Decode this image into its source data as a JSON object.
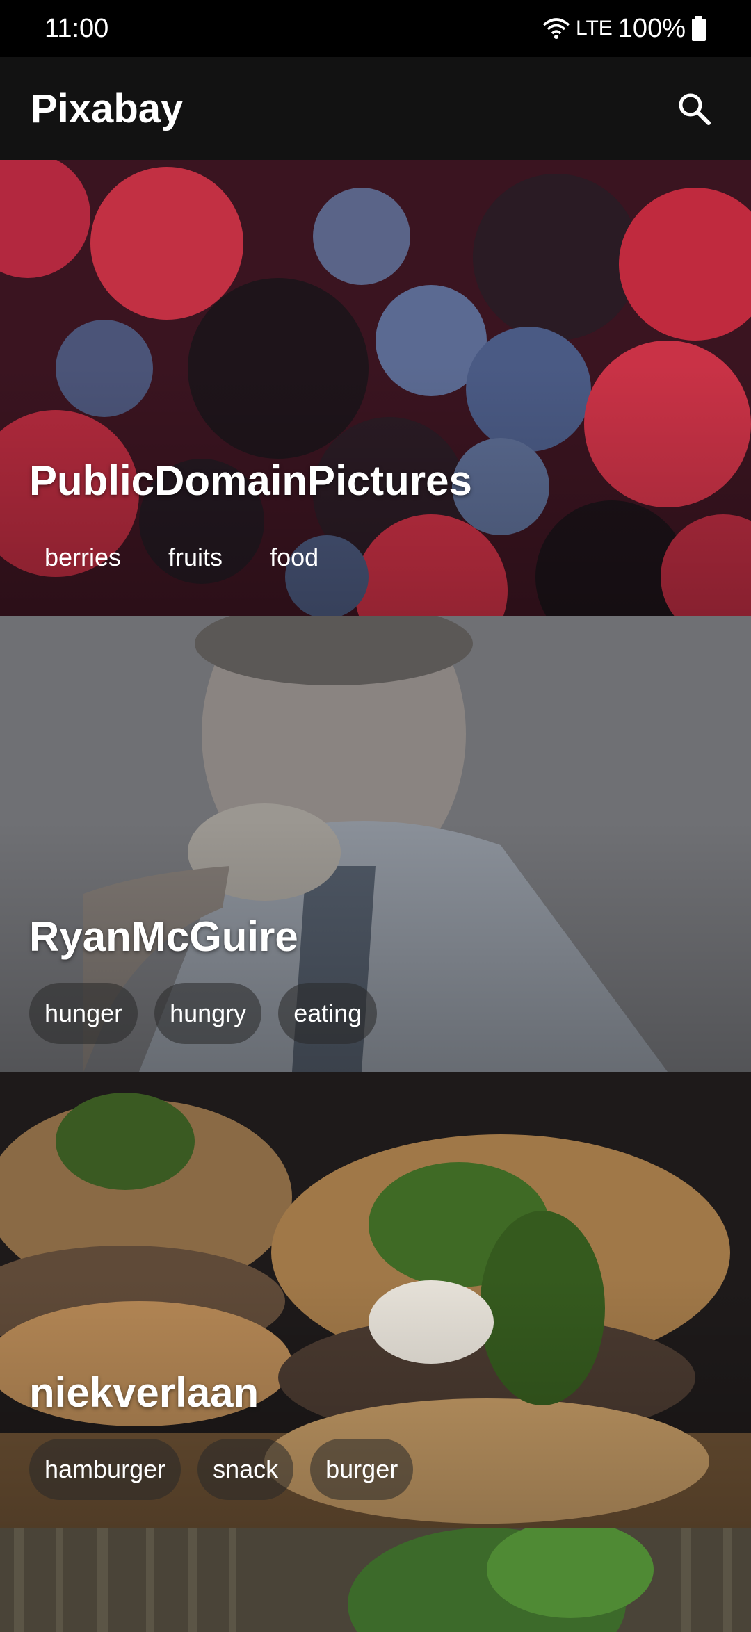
{
  "status_bar": {
    "time": "11:00",
    "network": "LTE",
    "battery": "100%"
  },
  "app_bar": {
    "title": "Pixabay",
    "search_icon": "search-icon"
  },
  "cards": [
    {
      "user": "PublicDomainPictures",
      "tags": [
        "berries",
        "fruits",
        "food"
      ]
    },
    {
      "user": "RyanMcGuire",
      "tags": [
        "hunger",
        "hungry",
        "eating"
      ]
    },
    {
      "user": "niekverlaan",
      "tags": [
        "hamburger",
        "snack",
        "burger"
      ]
    }
  ],
  "colors": {
    "app_bar_bg": "#121212",
    "status_bar_bg": "#000000",
    "tag_bg": "#3a3a3a"
  }
}
